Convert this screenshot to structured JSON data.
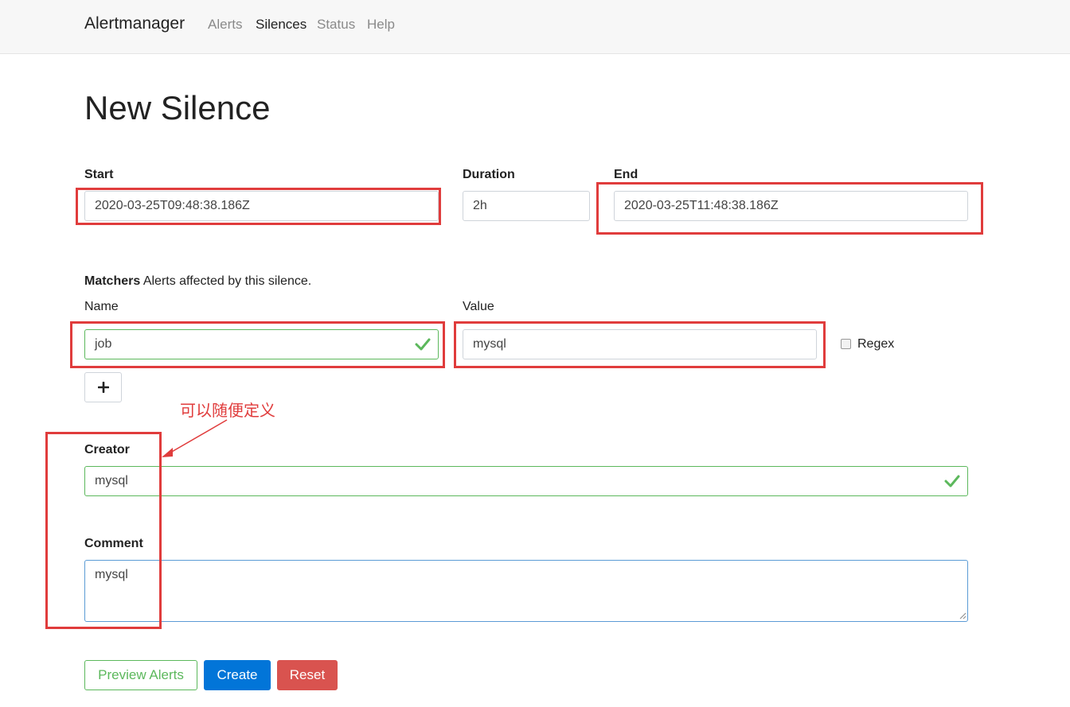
{
  "nav": {
    "brand": "Alertmanager",
    "links": [
      "Alerts",
      "Silences",
      "Status",
      "Help"
    ]
  },
  "page": {
    "title": "New Silence"
  },
  "form": {
    "start_label": "Start",
    "start_value": "2020-03-25T09:48:38.186Z",
    "duration_label": "Duration",
    "duration_value": "2h",
    "end_label": "End",
    "end_value": "2020-03-25T11:48:38.186Z",
    "matchers_label": "Matchers",
    "matchers_hint": "Alerts affected by this silence.",
    "name_label": "Name",
    "name_value": "job",
    "value_label": "Value",
    "value_value": "mysql",
    "regex_label": "Regex",
    "creator_label": "Creator",
    "creator_value": "mysql",
    "comment_label": "Comment",
    "comment_value": "mysql"
  },
  "annotation": {
    "text": "可以随便定义"
  },
  "buttons": {
    "preview": "Preview Alerts",
    "create": "Create",
    "reset": "Reset"
  },
  "colors": {
    "success": "#5cb85c",
    "primary": "#0275d8",
    "danger": "#d9534f",
    "annotation": "#e03c3c"
  }
}
